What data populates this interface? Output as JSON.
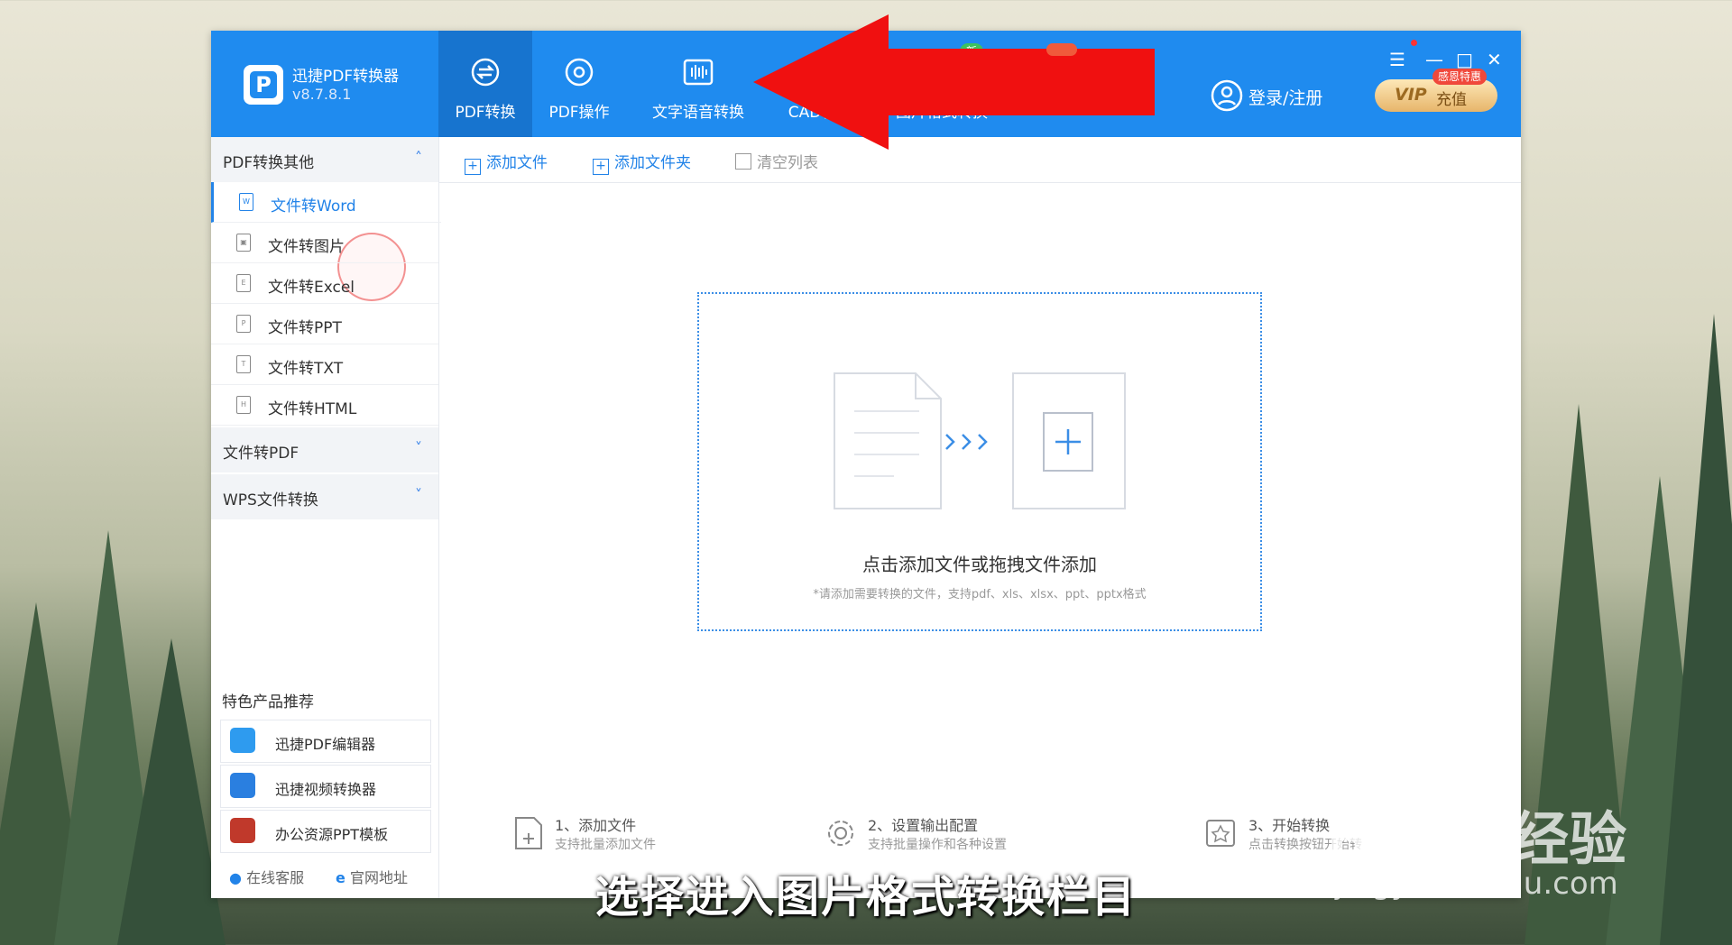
{
  "app": {
    "name": "迅捷PDF转换器",
    "version": "v8.7.8.1",
    "logo_letter": "P"
  },
  "nav": [
    {
      "label": "PDF转换",
      "icon": "pdf-convert-icon"
    },
    {
      "label": "PDF操作",
      "icon": "pdf-operate-icon"
    },
    {
      "label": "文字语音转换",
      "icon": "voice-icon"
    },
    {
      "label": "CAD转换",
      "icon": "cad-icon"
    },
    {
      "label": "图片格式转换",
      "icon": "image-icon",
      "badge": "新"
    }
  ],
  "header": {
    "login_label": "登录/注册",
    "vip_label": "VIP",
    "vip_action": "充值",
    "vip_tag": "感恩特惠"
  },
  "window_controls": {
    "menu": "☰",
    "minimize": "—",
    "maximize": "□",
    "close": "✕"
  },
  "sidebar": {
    "groups": [
      {
        "label": "PDF转换其他",
        "chevron": "˄"
      },
      {
        "label": "文件转PDF",
        "chevron": "˅"
      },
      {
        "label": "WPS文件转换",
        "chevron": "˅"
      }
    ],
    "items": [
      {
        "label": "文件转Word",
        "glyph": "W"
      },
      {
        "label": "文件转图片",
        "glyph": "▣"
      },
      {
        "label": "文件转Excel",
        "glyph": "E"
      },
      {
        "label": "文件转PPT",
        "glyph": "P"
      },
      {
        "label": "文件转TXT",
        "glyph": "T"
      },
      {
        "label": "文件转HTML",
        "glyph": "H"
      }
    ],
    "featured_title": "特色产品推荐",
    "featured": [
      {
        "label": "迅捷PDF编辑器",
        "color": "#2e9bef"
      },
      {
        "label": "迅捷视频转换器",
        "color": "#2a7fe0"
      },
      {
        "label": "办公资源PPT模板",
        "color": "#c0392b"
      }
    ],
    "footer": {
      "service": "在线客服",
      "site": "官网地址"
    }
  },
  "toolbar": {
    "add_file": "添加文件",
    "add_folder": "添加文件夹",
    "clear": "清空列表"
  },
  "dropzone": {
    "main": "点击添加文件或拖拽文件添加",
    "sub": "*请添加需要转换的文件，支持pdf、xls、xlsx、ppt、pptx格式"
  },
  "steps": [
    {
      "title": "1、添加文件",
      "sub": "支持批量添加文件"
    },
    {
      "title": "2、设置输出配置",
      "sub": "支持批量操作和各种设置"
    },
    {
      "title": "3、开始转换",
      "sub": "点击转换按钮开始转"
    }
  ],
  "caption": "选择进入图片格式转换栏目",
  "watermark": {
    "brand": "Baidu经验",
    "url": "jingyan.baidu.com"
  },
  "colors": {
    "primary": "#1f8bef",
    "arrow": "#f01010"
  }
}
